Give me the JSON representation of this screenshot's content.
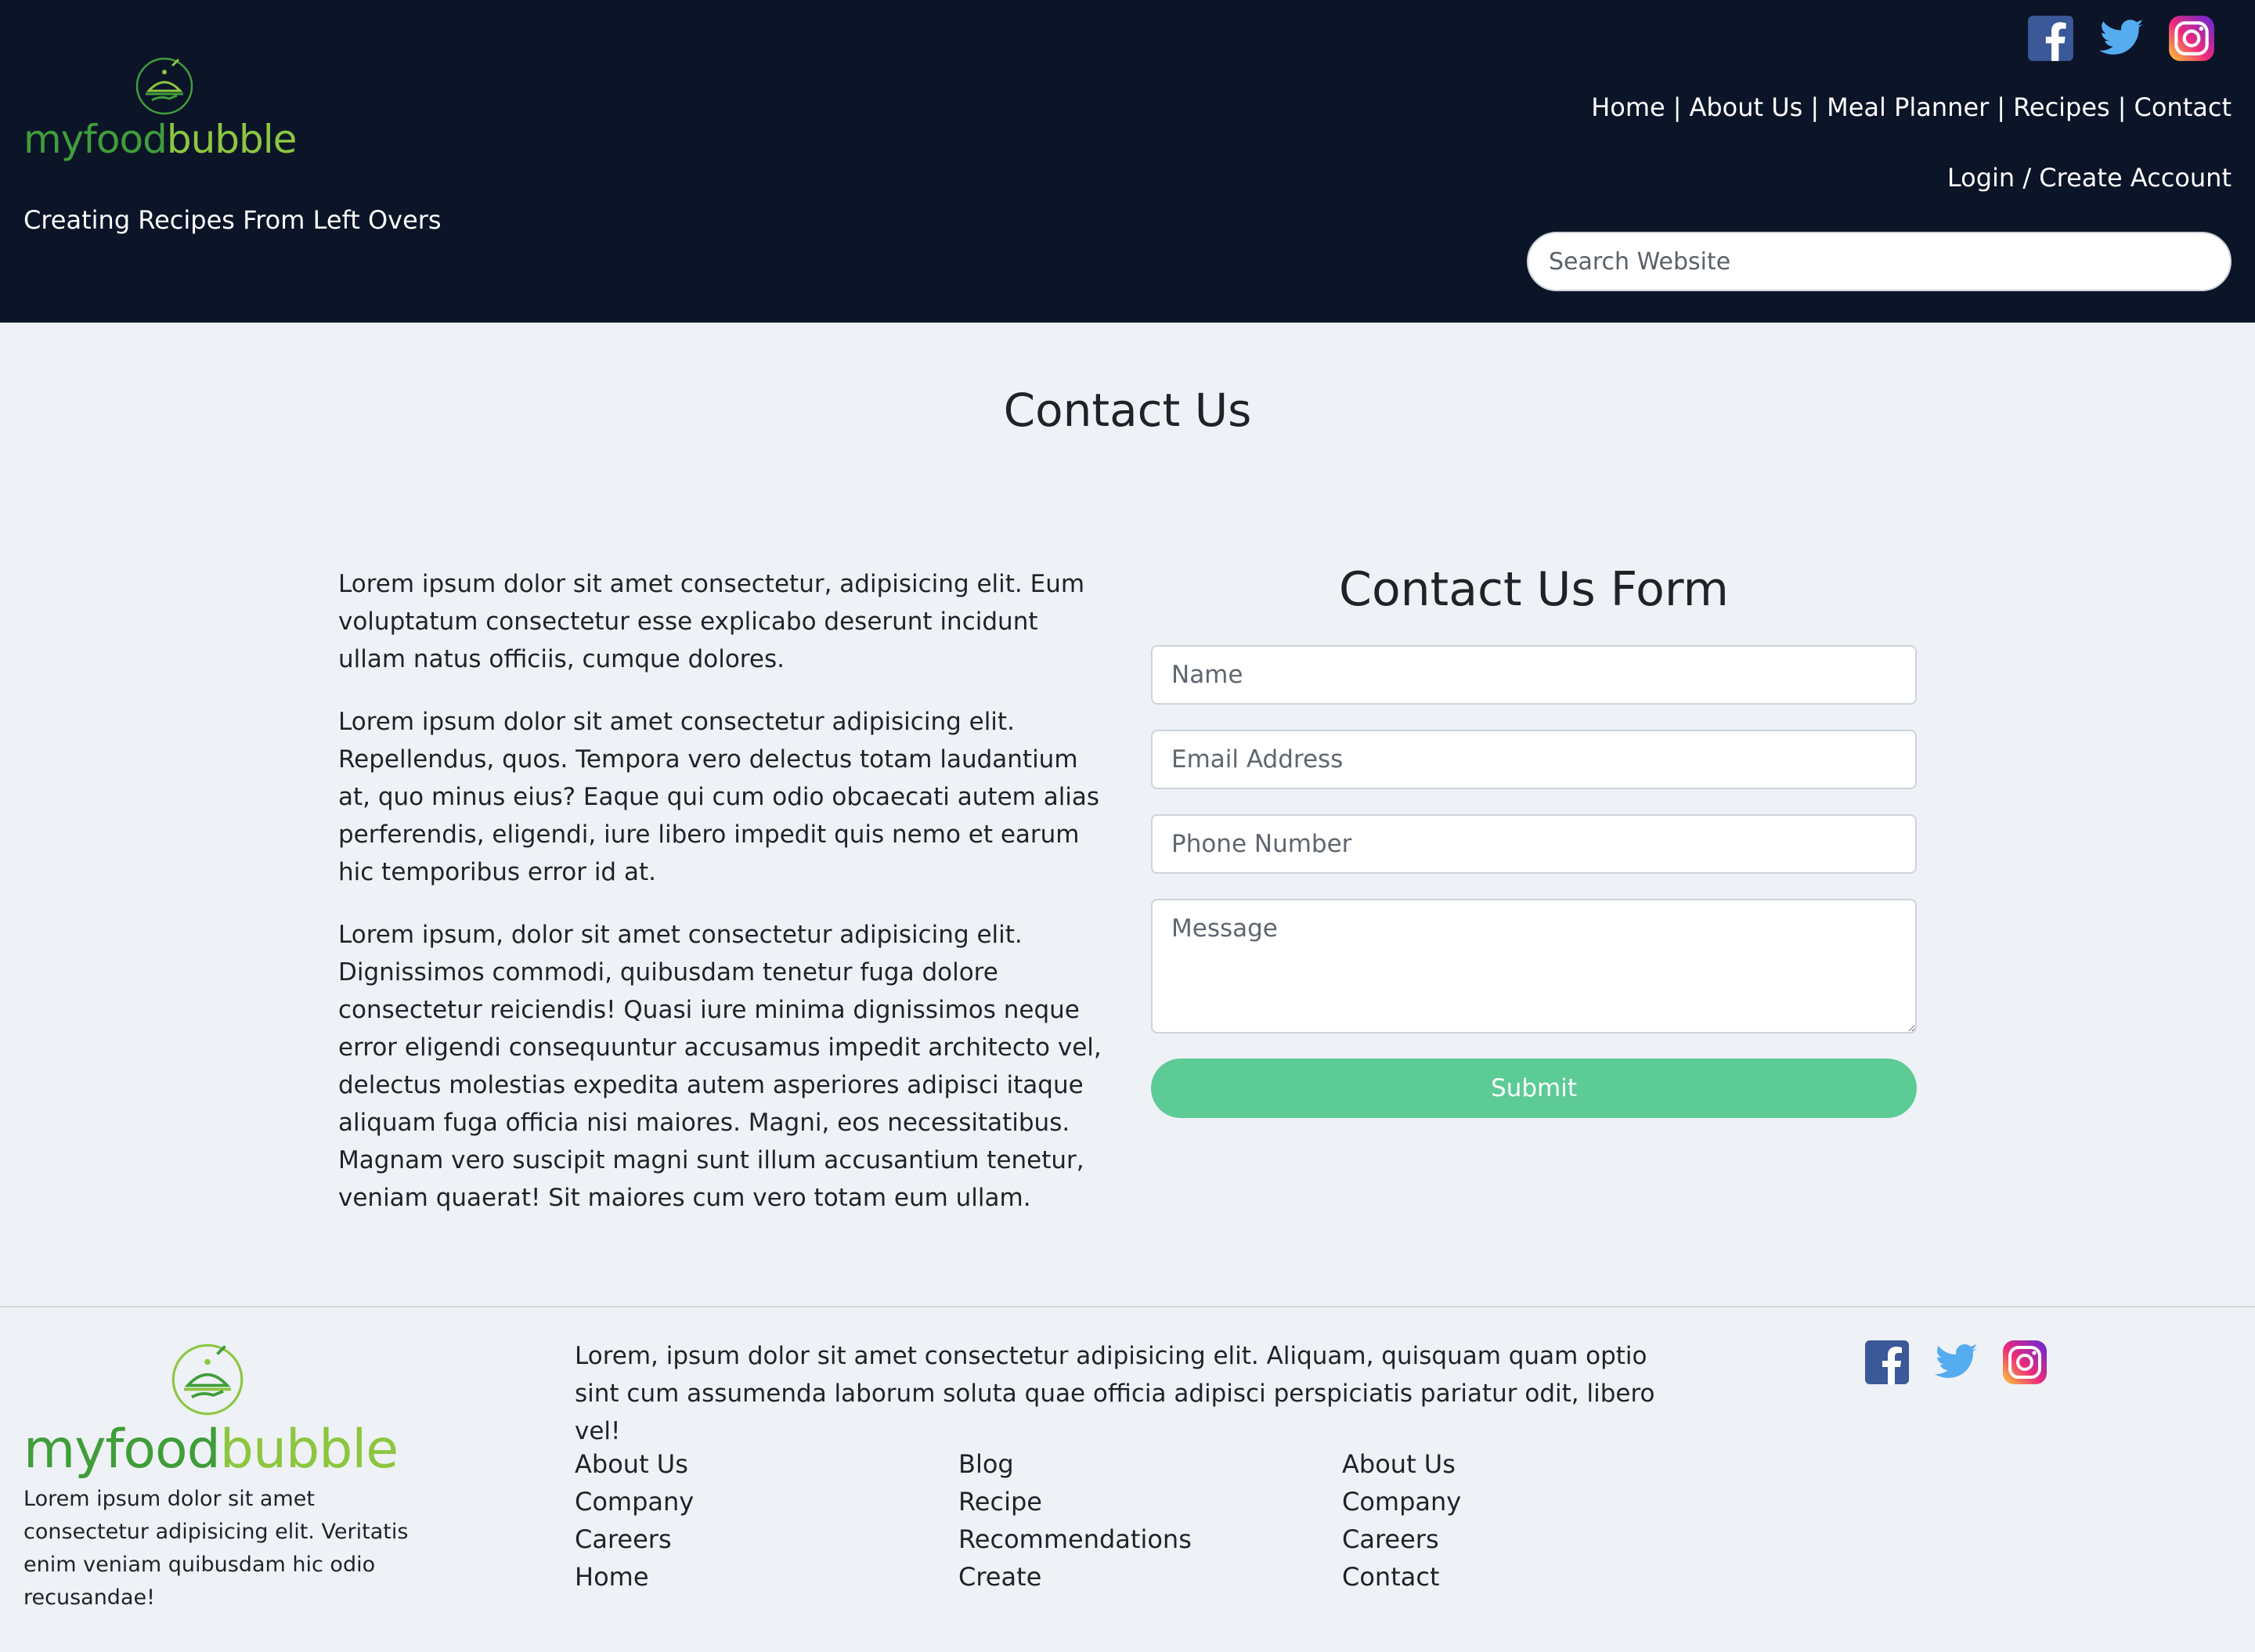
{
  "brand": {
    "part1": "myfood",
    "part2": "bubble"
  },
  "header": {
    "tagline": "Creating Recipes From Left Overs",
    "social": [
      "facebook-icon",
      "twitter-icon",
      "instagram-icon"
    ],
    "nav": [
      {
        "label": "Home"
      },
      {
        "label": "About Us"
      },
      {
        "label": "Meal Planner"
      },
      {
        "label": "Recipes"
      },
      {
        "label": "Contact"
      }
    ],
    "separator": "|",
    "login_label": "Login / Create Account",
    "search_placeholder": "Search Website"
  },
  "main": {
    "title": "Contact Us",
    "paragraphs": [
      "Lorem ipsum dolor sit amet consectetur, adipisicing elit. Eum voluptatum consectetur esse explicabo deserunt incidunt ullam natus officiis, cumque dolores.",
      "Lorem ipsum dolor sit amet consectetur adipisicing elit. Repellendus, quos. Tempora vero delectus totam laudantium at, quo minus eius? Eaque qui cum odio obcaecati autem alias perferendis, eligendi, iure libero impedit quis nemo et earum hic temporibus error id at.",
      "Lorem ipsum, dolor sit amet consectetur adipisicing elit. Dignissimos commodi, quibusdam tenetur fuga dolore consectetur reiciendis! Quasi iure minima dignissimos neque error eligendi consequuntur accusamus impedit architecto vel, delectus molestias expedita autem asperiores adipisci itaque aliquam fuga officia nisi maiores. Magni, eos necessitatibus. Magnam vero suscipit magni sunt illum accusantium tenetur, veniam quaerat! Sit maiores cum vero totam eum ullam."
    ],
    "form": {
      "title": "Contact Us Form",
      "name_placeholder": "Name",
      "email_placeholder": "Email Address",
      "phone_placeholder": "Phone Number",
      "message_placeholder": "Message",
      "submit_label": "Submit"
    }
  },
  "footer": {
    "about": "Lorem ipsum dolor sit amet consectetur adipisicing elit. Veritatis enim veniam quibusdam hic odio recusandae!",
    "description": "Lorem, ipsum dolor sit amet consectetur adipisicing elit. Aliquam, quisquam quam optio sint cum assumenda laborum soluta quae officia adipisci perspiciatis pariatur odit, libero vel!",
    "columns": [
      [
        "About Us",
        "Company",
        "Careers",
        "Home"
      ],
      [
        "Blog",
        "Recipe",
        "Recommendations",
        "Create"
      ],
      [
        "About Us",
        "Company",
        "Careers",
        "Contact"
      ]
    ],
    "social": [
      "facebook-icon",
      "twitter-icon",
      "instagram-icon"
    ]
  },
  "colors": {
    "header_bg": "#0c1428",
    "page_bg": "#eef1f5",
    "brand_dark_green": "#3f9d3a",
    "brand_light_green": "#8cc63f",
    "submit_green": "#5ccb96",
    "facebook": "#3b5998",
    "twitter": "#55acee"
  }
}
